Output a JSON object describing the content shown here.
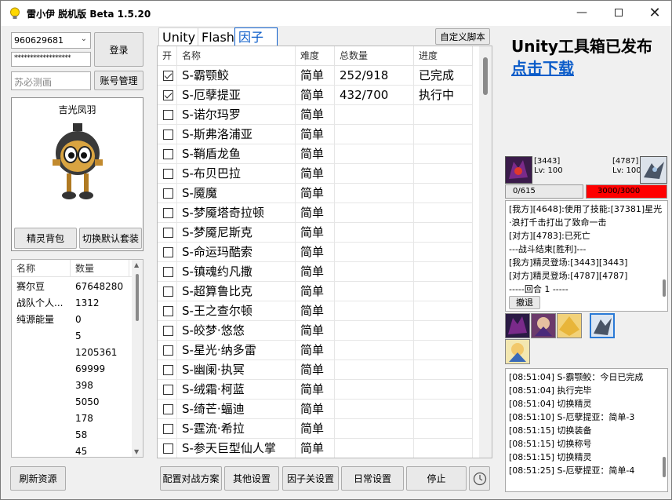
{
  "app": {
    "title": "雷小伊 脱机版 Beta 1.5.20"
  },
  "account": {
    "qq": "960629681",
    "password": "******************",
    "role_name": "苏必测画",
    "login_label": "登录",
    "manage_label": "账号管理"
  },
  "pet": {
    "name": "吉光凤羽",
    "bag_label": "精灵背包",
    "suit_label": "切换默认套装"
  },
  "resources": {
    "headers": [
      "名称",
      "数量"
    ],
    "rows": [
      {
        "name": "赛尔豆",
        "value": "67648280"
      },
      {
        "name": "战队个人...",
        "value": "1312"
      },
      {
        "name": "纯源能量",
        "value": "0"
      },
      {
        "name": "",
        "value": "5"
      },
      {
        "name": "",
        "value": "1205361"
      },
      {
        "name": "",
        "value": "69999"
      },
      {
        "name": "",
        "value": "398"
      },
      {
        "name": "",
        "value": "5050"
      },
      {
        "name": "",
        "value": "178"
      },
      {
        "name": "",
        "value": "58"
      },
      {
        "name": "",
        "value": "45"
      }
    ],
    "refresh_label": "刷新资源"
  },
  "tabs": [
    "Unity",
    "Flash",
    "因子"
  ],
  "custom_script_label": "自定义脚本",
  "task_table": {
    "headers": [
      "开",
      "名称",
      "难度",
      "总数量",
      "进度"
    ],
    "rows": [
      {
        "on": true,
        "name": "S-霸颚鲛",
        "diff": "简单",
        "total": "252/918",
        "progress": "已完成"
      },
      {
        "on": true,
        "name": "S-厄孽提亚",
        "diff": "简单",
        "total": "432/700",
        "progress": "执行中"
      },
      {
        "on": false,
        "name": "S-诺尔玛罗",
        "diff": "简单",
        "total": "",
        "progress": ""
      },
      {
        "on": false,
        "name": "S-斯弗洛浦亚",
        "diff": "简单",
        "total": "",
        "progress": ""
      },
      {
        "on": false,
        "name": "S-鞘盾龙鱼",
        "diff": "简单",
        "total": "",
        "progress": ""
      },
      {
        "on": false,
        "name": "S-布贝巴拉",
        "diff": "简单",
        "total": "",
        "progress": ""
      },
      {
        "on": false,
        "name": "S-魇魔",
        "diff": "简单",
        "total": "",
        "progress": ""
      },
      {
        "on": false,
        "name": "S-梦魇塔奇拉顿",
        "diff": "简单",
        "total": "",
        "progress": ""
      },
      {
        "on": false,
        "name": "S-梦魇尼斯克",
        "diff": "简单",
        "total": "",
        "progress": ""
      },
      {
        "on": false,
        "name": "S-命运玛酷索",
        "diff": "简单",
        "total": "",
        "progress": ""
      },
      {
        "on": false,
        "name": "S-镇魂约凡撒",
        "diff": "简单",
        "total": "",
        "progress": ""
      },
      {
        "on": false,
        "name": "S-超算鲁比克",
        "diff": "简单",
        "total": "",
        "progress": ""
      },
      {
        "on": false,
        "name": "S-王之查尔顿",
        "diff": "简单",
        "total": "",
        "progress": ""
      },
      {
        "on": false,
        "name": "S-皎梦·悠悠",
        "diff": "简单",
        "total": "",
        "progress": ""
      },
      {
        "on": false,
        "name": "S-星光·纳多雷",
        "diff": "简单",
        "total": "",
        "progress": ""
      },
      {
        "on": false,
        "name": "S-幽阑·执冥",
        "diff": "简单",
        "total": "",
        "progress": ""
      },
      {
        "on": false,
        "name": "S-绒霜·柯蓝",
        "diff": "简单",
        "total": "",
        "progress": ""
      },
      {
        "on": false,
        "name": "S-绮芒·蝠迪",
        "diff": "简单",
        "total": "",
        "progress": ""
      },
      {
        "on": false,
        "name": "S-霆流·希拉",
        "diff": "简单",
        "total": "",
        "progress": ""
      },
      {
        "on": false,
        "name": "S-参天巨型仙人掌",
        "diff": "简单",
        "total": "",
        "progress": ""
      }
    ]
  },
  "bottom_buttons": [
    "配置对战方案",
    "其他设置",
    "因子关设置",
    "日常设置",
    "停止"
  ],
  "ad": {
    "title": "Unity工具箱已发布",
    "link": "点击下载"
  },
  "battle": {
    "left_id": "[3443]",
    "left_lv": "Lv: 100",
    "right_id": "[4787]",
    "right_lv": "Lv: 100",
    "left_hp": "0/615",
    "right_hp": "3000/3000",
    "left_hp_fraction": 0,
    "right_hp_fraction": 1,
    "log": [
      "[我方][4648]:使用了技能:[37381]星光·浪打千击打出了致命一击",
      "[对方][4783]:已死亡",
      "---战斗结束[胜利]---",
      "[我方]精灵登场:[3443][3443]",
      "[对方]精灵登场:[4787][4787]",
      "-----回合 1 -----"
    ],
    "retreat_label": "撤退"
  },
  "run_log": [
    "[08:51:04] S-霸颚鲛：今日已完成",
    "[08:51:04]  执行完毕",
    "[08:51:04] 切换精灵",
    "[08:51:10] S-厄孽提亚：简单-3",
    "[08:51:15] 切换装备",
    "[08:51:15] 切换称号",
    "[08:51:15] 切换精灵",
    "[08:51:25] S-厄孽提亚：简单-4"
  ],
  "colors": {
    "accent": "#0b5cc9",
    "hp_red": "#ff0000",
    "link": "#0b5cc9"
  }
}
